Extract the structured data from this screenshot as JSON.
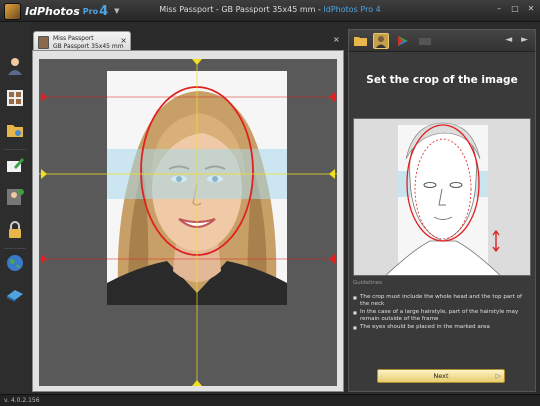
{
  "app": {
    "logo_text": "IdPhotos",
    "logo_pro": "Pro",
    "logo_version": "4",
    "window_title_doc": "Miss Passport - GB Passport 35x45 mm - ",
    "window_title_app": "IdPhotos Pro 4"
  },
  "window_controls": {
    "minimize": "–",
    "maximize": "□",
    "close": "✕"
  },
  "toolbar": {
    "icons": [
      "person-icon",
      "id-sheet-icon",
      "folder-view-icon",
      "edit-card-icon",
      "user-check-icon",
      "lock-icon",
      "globe-icon",
      "print-card-icon"
    ]
  },
  "document_tab": {
    "line1": "Miss Passport",
    "line2": "GB Passport 35x45 mm",
    "close": "×"
  },
  "editor": {
    "close": "×"
  },
  "right_panel": {
    "heading": "Set the crop of the image",
    "guidelines_label": "Guidelines",
    "guidelines": [
      "The crop must include the whole head and the top part of the neck",
      "In the case of a large hairstyle, part of the hairstyle may remain outside of the frame",
      "The eyes should be placed in the marked area"
    ],
    "next_label": "Next",
    "nav": "◄ ►"
  },
  "status": {
    "version": "v. 4.0.2.156"
  },
  "colors": {
    "accent": "#4fa3e0",
    "guide_red": "#e02020",
    "guide_yellow": "#f0e020",
    "eye_band": "#a8d8ec"
  }
}
